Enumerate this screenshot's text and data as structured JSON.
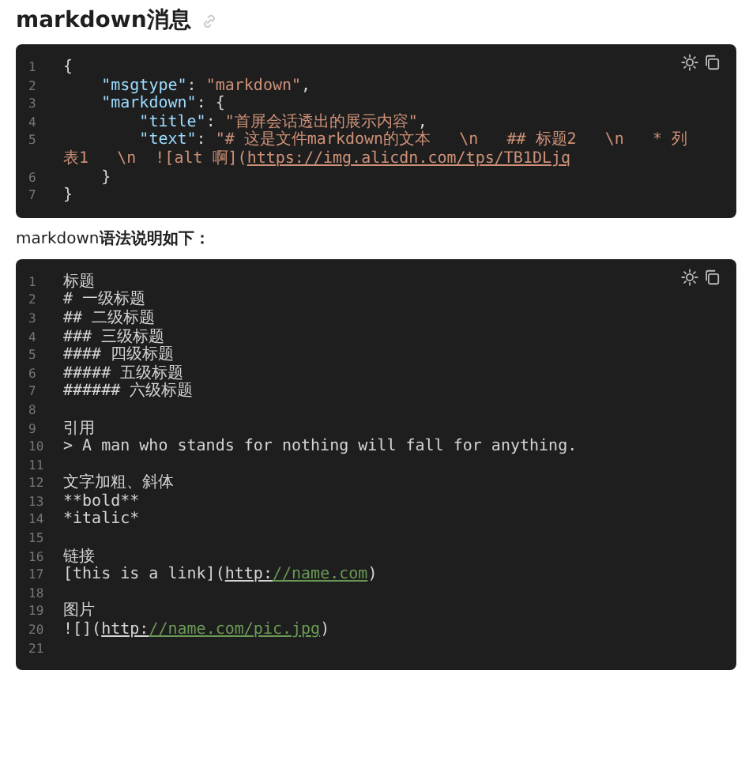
{
  "heading": {
    "text": "markdown消息"
  },
  "code_block_1": {
    "lines": [
      {
        "number": "1",
        "segments": [
          {
            "kind": "plain",
            "text": "{"
          }
        ]
      },
      {
        "number": "2",
        "segments": [
          {
            "kind": "key",
            "text": "    \"msgtype\""
          },
          {
            "kind": "plain",
            "text": ": "
          },
          {
            "kind": "string",
            "text": "\"markdown\""
          },
          {
            "kind": "plain",
            "text": ","
          }
        ]
      },
      {
        "number": "3",
        "segments": [
          {
            "kind": "key",
            "text": "    \"markdown\""
          },
          {
            "kind": "plain",
            "text": ": {"
          }
        ]
      },
      {
        "number": "4",
        "segments": [
          {
            "kind": "key",
            "text": "        \"title\""
          },
          {
            "kind": "plain",
            "text": ": "
          },
          {
            "kind": "string",
            "text": "\"首屏会话透出的展示内容\""
          },
          {
            "kind": "plain",
            "text": ","
          }
        ]
      },
      {
        "number": "5",
        "segments": [
          {
            "kind": "key",
            "text": "        \"text\""
          },
          {
            "kind": "plain",
            "text": ": "
          },
          {
            "kind": "string",
            "text": "\"# 这是文件markdown的文本   \\n   ## 标题2   \\n   * 列表1   \\n  ![alt 啊]("
          },
          {
            "kind": "link",
            "text": "https://img.alicdn.com/tps/TB1DLjq"
          }
        ]
      },
      {
        "number": "6",
        "segments": [
          {
            "kind": "plain",
            "text": "    }"
          }
        ]
      },
      {
        "number": "7",
        "segments": [
          {
            "kind": "plain",
            "text": "}"
          }
        ]
      }
    ]
  },
  "intro": {
    "text": "markdown**语法说明如下：**"
  },
  "code_block_2": {
    "lines": [
      {
        "number": "1",
        "segments": [
          {
            "kind": "plain",
            "text": "标题"
          }
        ]
      },
      {
        "number": "2",
        "segments": [
          {
            "kind": "plain",
            "text": "# 一级标题"
          }
        ]
      },
      {
        "number": "3",
        "segments": [
          {
            "kind": "plain",
            "text": "## 二级标题"
          }
        ]
      },
      {
        "number": "4",
        "segments": [
          {
            "kind": "plain",
            "text": "### 三级标题"
          }
        ]
      },
      {
        "number": "5",
        "segments": [
          {
            "kind": "plain",
            "text": "#### 四级标题"
          }
        ]
      },
      {
        "number": "6",
        "segments": [
          {
            "kind": "plain",
            "text": "##### 五级标题"
          }
        ]
      },
      {
        "number": "7",
        "segments": [
          {
            "kind": "plain",
            "text": "###### 六级标题"
          }
        ]
      },
      {
        "number": "8"
      },
      {
        "number": "9",
        "segments": [
          {
            "kind": "plain",
            "text": "引用"
          }
        ]
      },
      {
        "number": "10",
        "segments": [
          {
            "kind": "plain",
            "text": "> A man who stands for nothing will fall for anything."
          }
        ]
      },
      {
        "number": "11"
      },
      {
        "number": "12",
        "segments": [
          {
            "kind": "plain",
            "text": "文字加粗、斜体"
          }
        ]
      },
      {
        "number": "13",
        "segments": [
          {
            "kind": "plain",
            "text": "**bold**"
          }
        ]
      },
      {
        "number": "14",
        "segments": [
          {
            "kind": "plain",
            "text": "*italic*"
          }
        ]
      },
      {
        "number": "15"
      },
      {
        "number": "16",
        "segments": [
          {
            "kind": "plain",
            "text": "链接"
          }
        ]
      },
      {
        "number": "17",
        "segments": [
          {
            "kind": "plain",
            "text": "[this is a link]("
          },
          {
            "kind": "scheme",
            "text": "http:"
          },
          {
            "kind": "urlrest",
            "text": "//name.com"
          },
          {
            "kind": "plain",
            "text": ")"
          }
        ]
      },
      {
        "number": "18"
      },
      {
        "number": "19",
        "segments": [
          {
            "kind": "plain",
            "text": "图片"
          }
        ]
      },
      {
        "number": "20",
        "segments": [
          {
            "kind": "plain",
            "text": "![]("
          },
          {
            "kind": "scheme",
            "text": "http:"
          },
          {
            "kind": "urlrest",
            "text": "//name.com/pic.jpg"
          },
          {
            "kind": "plain",
            "text": ")"
          }
        ]
      },
      {
        "number": "21"
      }
    ]
  }
}
